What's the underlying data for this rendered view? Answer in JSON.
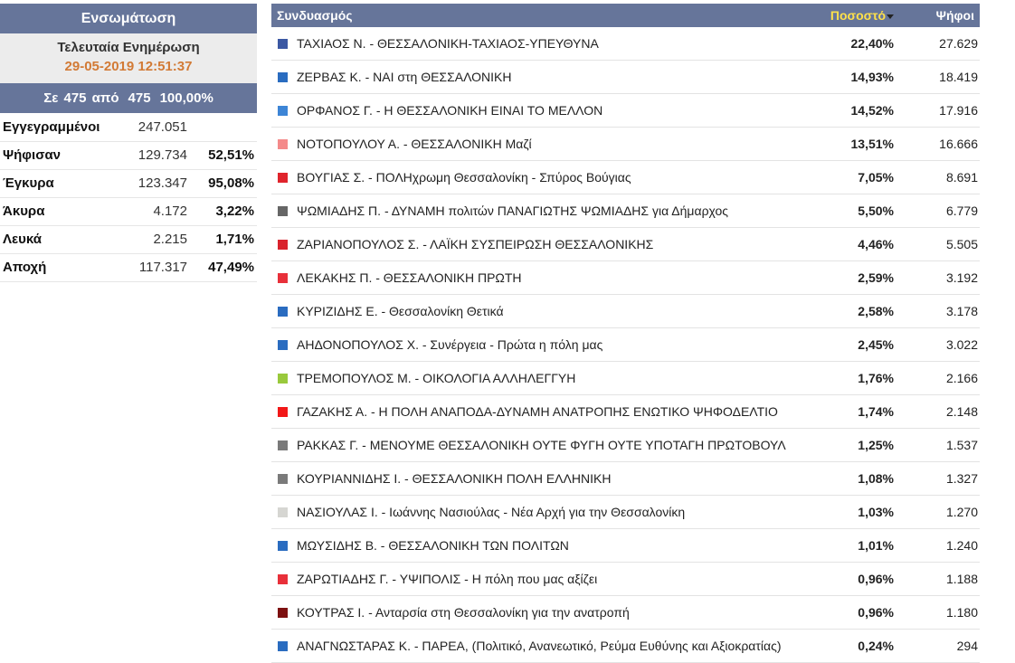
{
  "summary": {
    "title": "Ενσωμάτωση",
    "update_label": "Τελευταία Ενημέρωση",
    "update_time": "29-05-2019 12:51:37",
    "progress": {
      "prefix": "Σε 475 από",
      "total": "475",
      "percent": "100,00%"
    },
    "stats": [
      {
        "label": "Εγγεγραμμένοι",
        "count": "247.051",
        "pct": ""
      },
      {
        "label": "Ψήφισαν",
        "count": "129.734",
        "pct": "52,51%"
      },
      {
        "label": "Έγκυρα",
        "count": "123.347",
        "pct": "95,08%"
      },
      {
        "label": "Άκυρα",
        "count": "4.172",
        "pct": "3,22%"
      },
      {
        "label": "Λευκά",
        "count": "2.215",
        "pct": "1,71%"
      },
      {
        "label": "Αποχή",
        "count": "117.317",
        "pct": "47,49%"
      }
    ]
  },
  "results": {
    "headers": {
      "name": "Συνδυασμός",
      "pct": "Ποσοστό",
      "votes": "Ψήφοι"
    },
    "rows": [
      {
        "name": "ΤΑΧΙΑΟΣ Ν. - ΘΕΣΣΑΛΟΝΙΚΗ-ΤΑΧΙΑΟΣ-ΥΠΕΥΘΥΝΑ",
        "pct": "22,40%",
        "votes": "27.629",
        "color": "#3b58a3"
      },
      {
        "name": "ΖΕΡΒΑΣ Κ. - ΝΑΙ στη ΘΕΣΣΑΛΟΝΙΚΗ",
        "pct": "14,93%",
        "votes": "18.419",
        "color": "#2a6cc0"
      },
      {
        "name": "ΟΡΦΑΝΟΣ Γ. - Η ΘΕΣΣΑΛΟΝΙΚΗ ΕΙΝΑΙ ΤΟ ΜΕΛΛΟΝ",
        "pct": "14,52%",
        "votes": "17.916",
        "color": "#3d85d6"
      },
      {
        "name": "ΝΟΤΟΠΟΥΛΟΥ Α. - ΘΕΣΣΑΛΟΝΙΚΗ Μαζί",
        "pct": "13,51%",
        "votes": "16.666",
        "color": "#f48a8a"
      },
      {
        "name": "ΒΟΥΓΙΑΣ Σ. - ΠΟΛΗχρωμη Θεσσαλονίκη - Σπύρος Βούγιας",
        "pct": "7,05%",
        "votes": "8.691",
        "color": "#e0242c"
      },
      {
        "name": "ΨΩΜΙΑΔΗΣ Π. - ΔΥΝΑΜΗ πολιτών ΠΑΝΑΓΙΩΤΗΣ ΨΩΜΙΑΔΗΣ για Δήμαρχος",
        "pct": "5,50%",
        "votes": "6.779",
        "color": "#666666"
      },
      {
        "name": "ΖΑΡΙΑΝΟΠΟΥΛΟΣ Σ. - ΛΑΪΚΗ ΣΥΣΠΕΙΡΩΣΗ ΘΕΣΣΑΛΟΝΙΚΗΣ",
        "pct": "4,46%",
        "votes": "5.505",
        "color": "#d9232d"
      },
      {
        "name": "ΛΕΚΑΚΗΣ Π. - ΘΕΣΣΑΛΟΝΙΚΗ ΠΡΩΤΗ",
        "pct": "2,59%",
        "votes": "3.192",
        "color": "#e8303a"
      },
      {
        "name": "ΚΥΡΙΖΙΔΗΣ Ε. - Θεσσαλονίκη Θετικά",
        "pct": "2,58%",
        "votes": "3.178",
        "color": "#2a6cc0"
      },
      {
        "name": "ΑΗΔΟΝΟΠΟΥΛΟΣ Χ. - Συνέργεια - Πρώτα η πόλη μας",
        "pct": "2,45%",
        "votes": "3.022",
        "color": "#2a6cc0"
      },
      {
        "name": "ΤΡΕΜΟΠΟΥΛΟΣ Μ. - ΟΙΚΟΛΟΓΙΑ ΑΛΛΗΛΕΓΓΥΗ",
        "pct": "1,76%",
        "votes": "2.166",
        "color": "#99c93c"
      },
      {
        "name": "ΓΑΖΑΚΗΣ Α. - Η ΠΟΛΗ ΑΝΑΠΟΔΑ-ΔΥΝΑΜΗ ΑΝΑΤΡΟΠΗΣ ΕΝΩΤΙΚΟ ΨΗΦΟΔΕΛΤΙΟ",
        "pct": "1,74%",
        "votes": "2.148",
        "color": "#f21818"
      },
      {
        "name": "ΡΑΚΚΑΣ Γ. - ΜΕΝΟΥΜΕ ΘΕΣΣΑΛΟΝΙΚΗ ΟΥΤΕ ΦΥΓΗ ΟΥΤΕ ΥΠΟΤΑΓΗ ΠΡΩΤΟΒΟΥΛ",
        "pct": "1,25%",
        "votes": "1.537",
        "color": "#7a7a7a"
      },
      {
        "name": "ΚΟΥΡΙΑΝΝΙΔΗΣ Ι. - ΘΕΣΣΑΛΟΝΙΚΗ ΠΟΛΗ ΕΛΛΗΝΙΚΗ",
        "pct": "1,08%",
        "votes": "1.327",
        "color": "#7a7a7a"
      },
      {
        "name": "ΝΑΣΙΟΥΛΑΣ Ι. - Ιωάννης Νασιούλας - Νέα Αρχή για την Θεσσαλονίκη",
        "pct": "1,03%",
        "votes": "1.270",
        "color": "#d6d6d2"
      },
      {
        "name": "ΜΩΥΣΙΔΗΣ Β. - ΘΕΣΣΑΛΟΝΙΚΗ ΤΩΝ ΠΟΛΙΤΩΝ",
        "pct": "1,01%",
        "votes": "1.240",
        "color": "#2a6cc0"
      },
      {
        "name": "ΖΑΡΩΤΙΑΔΗΣ Γ. - ΥΨΙΠΟΛΙΣ - Η πόλη που μας αξίζει",
        "pct": "0,96%",
        "votes": "1.188",
        "color": "#e8303a"
      },
      {
        "name": "ΚΟΥΤΡΑΣ Ι. - Ανταρσία στη Θεσσαλονίκη για την ανατροπή",
        "pct": "0,96%",
        "votes": "1.180",
        "color": "#7d1010"
      },
      {
        "name": "ΑΝΑΓΝΩΣΤΑΡΑΣ Κ. - ΠΑΡΕΑ, (Πολιτικό, Ανανεωτικό, Ρεύμα Ευθύνης και Αξιοκρατίας)",
        "pct": "0,24%",
        "votes": "294",
        "color": "#2a6cc0"
      }
    ]
  }
}
